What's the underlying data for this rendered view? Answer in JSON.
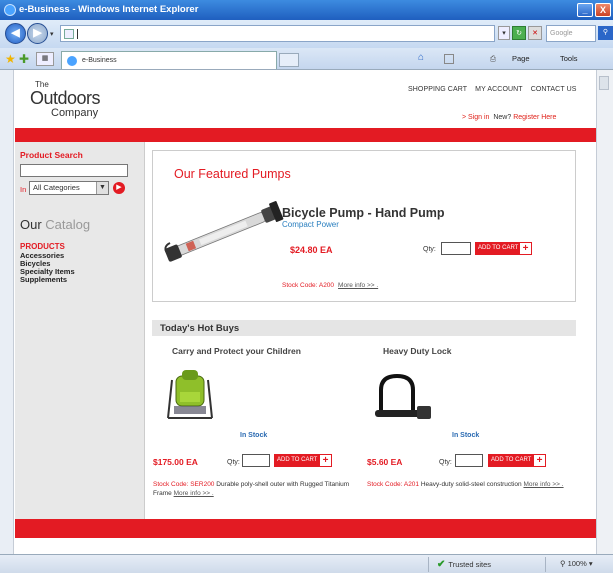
{
  "window": {
    "title": "e-Business - Windows Internet Explorer",
    "minimize": "_",
    "close": "X"
  },
  "addressbar": {
    "url": "",
    "search_placeholder": "Google"
  },
  "tabs": [
    {
      "label": "e-Business"
    }
  ],
  "commandbar": {
    "page": "Page",
    "tools": "Tools"
  },
  "site": {
    "logo": {
      "the": "The",
      "main": "Outdoors",
      "company": "Company"
    },
    "topnav": [
      "SHOPPING CART",
      "MY ACCOUNT",
      "CONTACT US"
    ],
    "signin": {
      "prefix": "> ",
      "signin": "Sign in",
      "new": "New?",
      "register": "Register Here"
    }
  },
  "sidebar": {
    "search_label": "Product Search",
    "in_label": "In",
    "category_selected": "All Categories",
    "catalog_title_main": "Our ",
    "catalog_title_lite": "Catalog",
    "products_heading": "PRODUCTS",
    "categories": [
      "Accessories",
      "Bicycles",
      "Specialty Items",
      "Supplements"
    ]
  },
  "featured": {
    "title": "Our Featured Pumps",
    "product_name": "Bicycle Pump - Hand Pump",
    "product_subtitle": "Compact Power",
    "price": "$24.80 EA",
    "qty_label": "Qty:",
    "add_to_cart": "ADD TO CART",
    "stock_code": "Stock Code: A200",
    "more_info": "More info >> ."
  },
  "hot_buys": {
    "title": "Today's Hot Buys",
    "items": [
      {
        "title": "Carry and Protect your Children",
        "stock_status": "In Stock",
        "price": "$175.00 EA",
        "qty_label": "Qty:",
        "add_to_cart": "ADD TO CART",
        "stock_code": "Stock Code: SER200",
        "description": " Durable poly-shell outer with Rugged Titanium Frame ",
        "more_info": "More info >> ."
      },
      {
        "title": "Heavy Duty Lock",
        "stock_status": "In Stock",
        "price": "$5.60 EA",
        "qty_label": "Qty:",
        "add_to_cart": "ADD TO CART",
        "stock_code": "Stock Code: A201",
        "description": " Heavy-duty solid-steel construction ",
        "more_info": "More info >> ."
      }
    ]
  },
  "statusbar": {
    "zone": "Trusted sites",
    "zoom": "100%"
  },
  "colors": {
    "brand_red": "#e31b23",
    "link_blue": "#2a7fbf",
    "ie_blue": "#1f5fbf"
  }
}
